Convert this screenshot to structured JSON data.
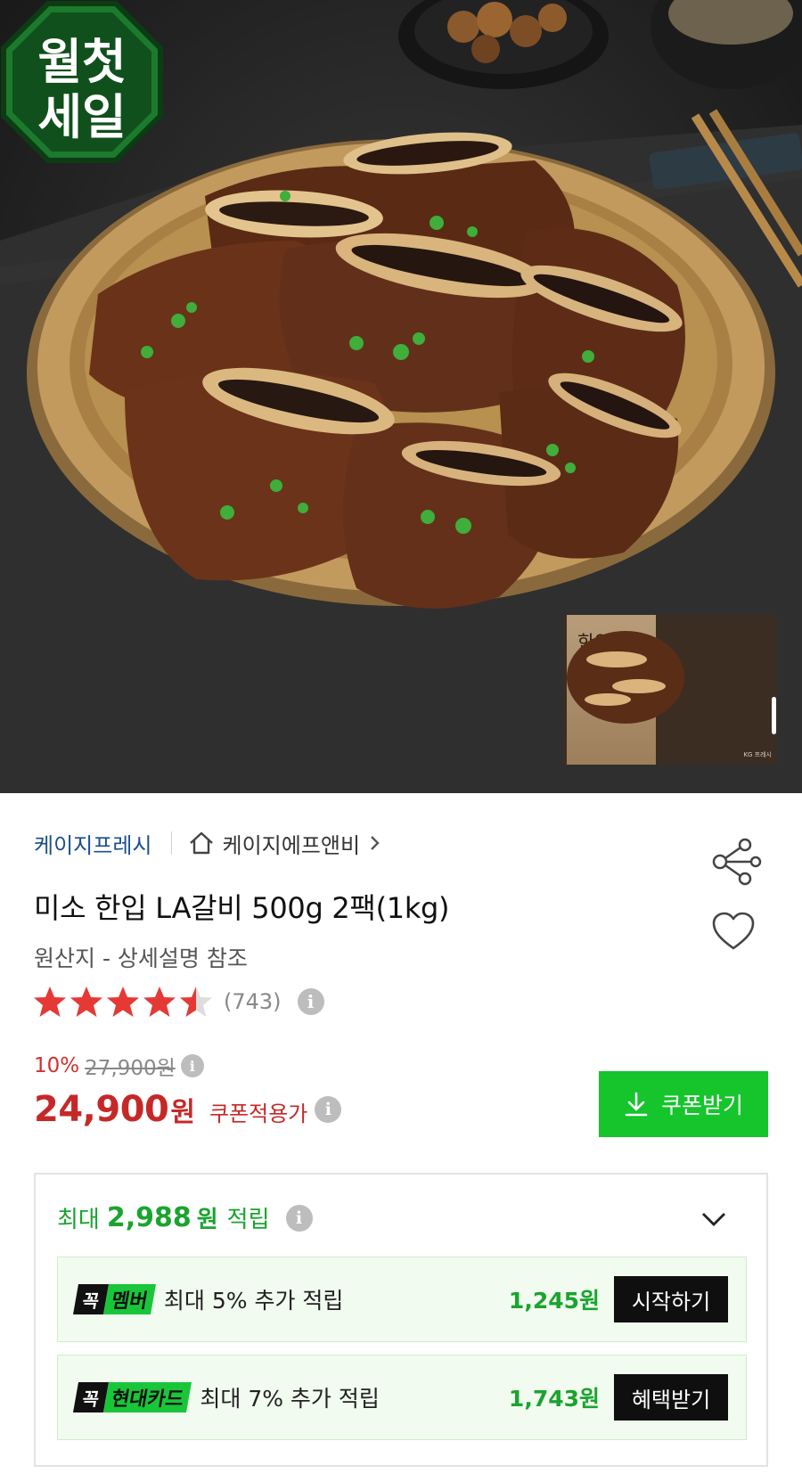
{
  "product_image": {
    "badge_text": [
      "월첫",
      "세일"
    ],
    "thumbnail": {
      "title": "한입 LA갈비",
      "brand": "KG 프레시"
    }
  },
  "seller": {
    "name": "케이지프레시",
    "store_name": "케이지에프앤비",
    "home_icon": "home-icon",
    "chevron_icon": "chevron-right-icon"
  },
  "actions": {
    "share_icon": "share-icon",
    "like_icon": "heart-icon"
  },
  "product": {
    "title": "미소 한입 LA갈비 500g 2팩(1kg)",
    "origin": "원산지 - 상세설명 참조"
  },
  "rating": {
    "value": 4.5,
    "max": 5,
    "count_text": "(743)",
    "info_icon": "i"
  },
  "price": {
    "discount_rate": "10%",
    "original_price": "27,900원",
    "sale_price": "24,900",
    "currency_unit": "원",
    "coupon_note": "쿠폰적용가",
    "info_icon": "i"
  },
  "coupon_button": {
    "label": "쿠폰받기",
    "icon": "download-icon"
  },
  "points": {
    "prefix": "최대",
    "amount": "2,988",
    "unit": "원",
    "suffix": "적립",
    "info_icon": "i",
    "expand_icon": "chevron-down-icon",
    "benefits": [
      {
        "tag_left": "꼭",
        "tag_right": "멤버",
        "description": "최대 5% 추가 적립",
        "amount": "1,245원",
        "button_label": "시작하기"
      },
      {
        "tag_left": "꼭",
        "tag_right": "현대카드",
        "description": "최대 7% 추가 적립",
        "amount": "1,743원",
        "button_label": "혜택받기"
      }
    ]
  },
  "colors": {
    "accent_green": "#16c42c",
    "points_green": "#1aa42f",
    "price_red": "#c62828",
    "seller_blue": "#1a4f8f",
    "star_red": "#e53935"
  }
}
